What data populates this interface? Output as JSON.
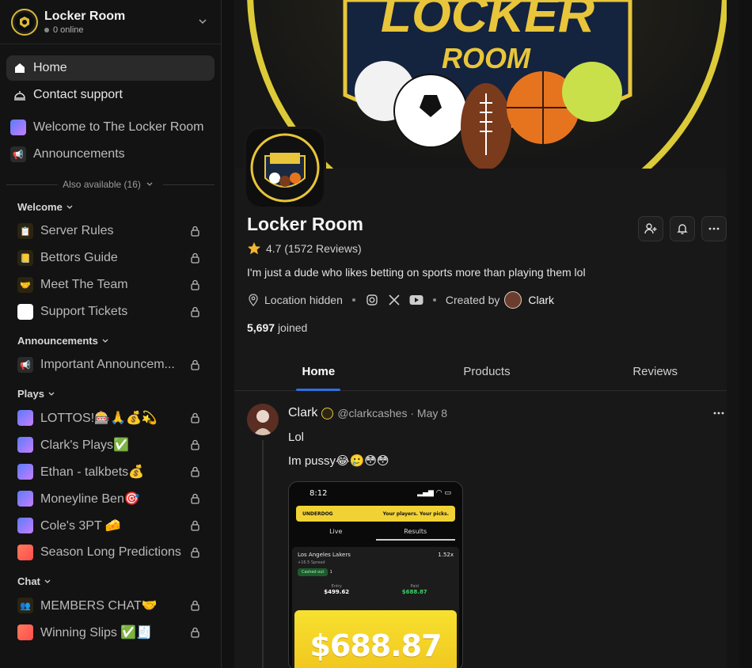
{
  "workspace": {
    "name": "Locker Room",
    "online": "0 online"
  },
  "nav": {
    "home": "Home",
    "contact": "Contact support",
    "welcome_channel": "Welcome to The Locker Room",
    "announcements_channel": "Announcements"
  },
  "also_available": "Also available (16)",
  "sections": [
    {
      "title": "Welcome",
      "channels": [
        "Server Rules",
        "Bettors Guide",
        "Meet The Team",
        "Support Tickets"
      ]
    },
    {
      "title": "Announcements",
      "channels": [
        "Important Announcem..."
      ]
    },
    {
      "title": "Plays",
      "channels": [
        "LOTTOS!🎰🙏💰💫",
        "Clark's Plays✅",
        "Ethan - talkbets💰",
        "Moneyline Ben🎯",
        "Cole's 3PT 🧀",
        "Season Long Predictions"
      ]
    },
    {
      "title": "Chat",
      "channels": [
        "MEMBERS CHAT🤝",
        "Winning Slips ✅🧾"
      ]
    }
  ],
  "profile": {
    "title": "Locker Room",
    "rating": "4.7",
    "reviews": "(1572 Reviews)",
    "description": "I'm just a dude who likes betting on sports more than playing them lol",
    "location": "Location hidden",
    "created_by_label": "Created by",
    "creator": "Clark",
    "joined_count": "5,697",
    "joined_label": "joined"
  },
  "tabs": [
    "Home",
    "Products",
    "Reviews"
  ],
  "post": {
    "author": "Clark",
    "handle": "@clarkcashes",
    "date": "· May 8",
    "text1": "Lol",
    "text2": "Im pussy😂🥲😳😳"
  },
  "slip": {
    "time": "8:12",
    "brand": "UNDERDOG",
    "tagline": "Your players. Your picks.",
    "tab_live": "Live",
    "tab_results": "Results",
    "team": "Los Angeles Lakers",
    "multiplier": "1.52x",
    "spread": "+16.5 Spread",
    "cashed": "Cashed out",
    "cashed_count": "1",
    "entry_label": "Entry",
    "entry_value": "$499.62",
    "paid_label": "Paid",
    "paid_value": "$688.87",
    "big_amount": "$688.87"
  },
  "banner_text": {
    "line1": "LOCKER",
    "line2": "ROOM"
  },
  "colors": {
    "accent": "#2f6fe0",
    "gold": "#e8c53a",
    "star": "#f5b531"
  }
}
